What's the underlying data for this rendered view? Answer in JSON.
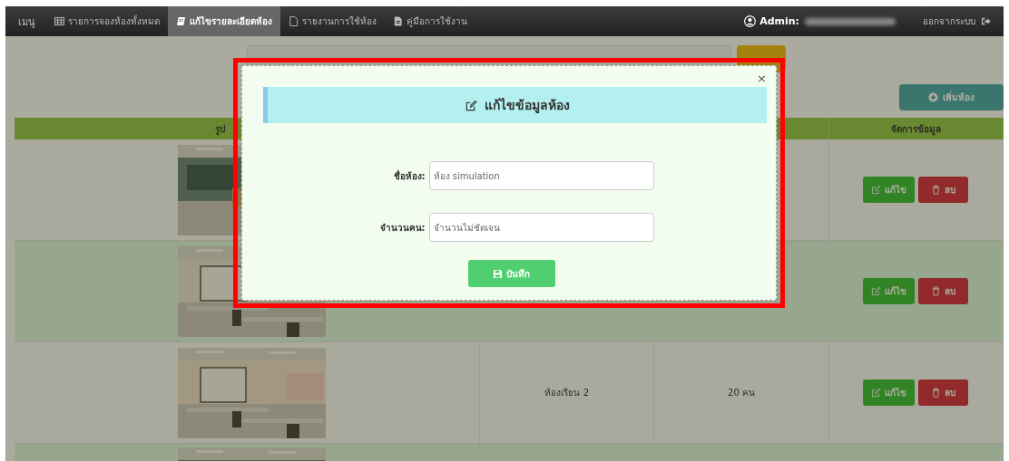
{
  "nav": {
    "menu_label": "เมนู",
    "items": [
      {
        "kind": "table",
        "label": "รายการจองห้องทั้งหมด",
        "selected": false
      },
      {
        "kind": "book",
        "label": "แก้ไขรายละเอียดห้อง",
        "selected": true
      },
      {
        "kind": "file",
        "label": "รายงานการใช้ห้อง",
        "selected": false
      },
      {
        "kind": "doc",
        "label": "คู่มือการใช้งาน",
        "selected": false
      }
    ],
    "admin_label": "Admin:",
    "logout_label": "ออกจากระบบ"
  },
  "add_button": "เพิ่มห้อง",
  "table": {
    "columns": [
      {
        "label": "รูป"
      },
      {},
      {},
      {
        "label": "จัดการข้อมูล"
      }
    ],
    "rows": [
      {
        "image": {
          "kind": "picture"
        },
        "actions": {
          "edit": "แก้ไข",
          "delete": "ลบ"
        }
      },
      {
        "image": {
          "kind": "picture"
        },
        "actions": {
          "edit": "แก้ไข",
          "delete": "ลบ"
        }
      },
      {
        "image": {
          "kind": "picture"
        },
        "name": "ห้องเรียน 2",
        "capacity": "20 คน",
        "actions": {
          "edit": "แก้ไข",
          "delete": "ลบ"
        }
      },
      {
        "image": {
          "kind": "picture"
        }
      }
    ]
  },
  "modal": {
    "title": "แก้ไขข้อมูลห้อง",
    "close": "×",
    "fields": [
      {
        "label": "ชื่อห้อง:",
        "value": "ห้อง simulation"
      },
      {
        "label": "จำนวนคน:",
        "value": "จำนวนไม่ชัดเจน"
      }
    ],
    "save_button": "บันทึก"
  }
}
